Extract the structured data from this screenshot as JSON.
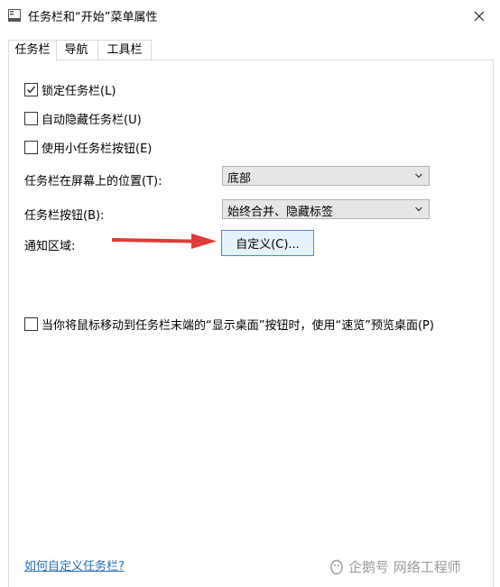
{
  "window": {
    "title": "任务栏和“开始”菜单属性"
  },
  "tabs": [
    {
      "label": "任务栏"
    },
    {
      "label": "导航"
    },
    {
      "label": "工具栏"
    }
  ],
  "options": {
    "lock": {
      "label": "锁定任务栏(L)",
      "checked": true
    },
    "autohide": {
      "label": "自动隐藏任务栏(U)",
      "checked": false
    },
    "small": {
      "label": "使用小任务栏按钮(E)",
      "checked": false
    },
    "peek": {
      "label": "当你将鼠标移动到任务栏末端的“显示桌面”按钮时，使用“速览”预览桌面(P)",
      "checked": false
    }
  },
  "position": {
    "label": "任务栏在屏幕上的位置(T):",
    "value": "底部"
  },
  "buttons": {
    "label": "任务栏按钮(B):",
    "value": "始终合并、隐藏标签"
  },
  "notify": {
    "label": "通知区域:",
    "button_label": "自定义(C)..."
  },
  "help_link": "如何自定义任务栏?",
  "watermark": "企鹅号 网络工程师",
  "colors": {
    "accent": "#3c8fd6",
    "link": "#2a6cb8",
    "annotation_arrow": "#e03a3a"
  }
}
